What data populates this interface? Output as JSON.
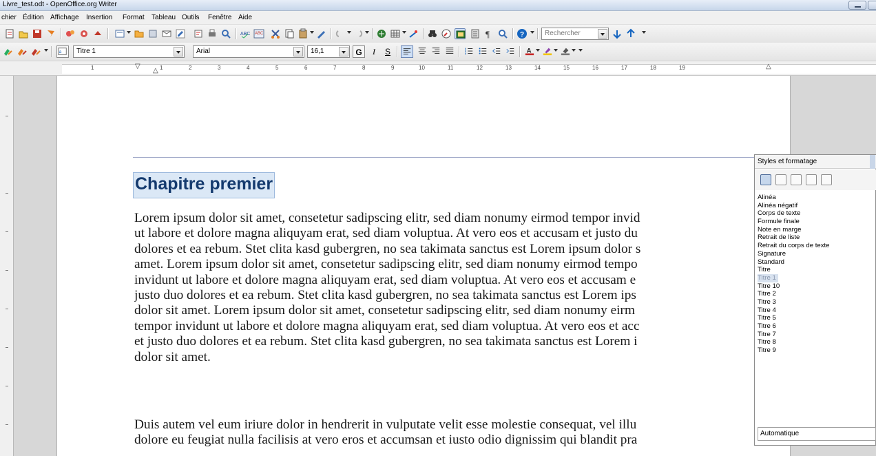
{
  "window": {
    "title": "Livre_test.odt - OpenOffice.org Writer"
  },
  "menu": [
    "chier",
    "Édition",
    "Affichage",
    "Insertion",
    "Format",
    "Tableau",
    "Outils",
    "Fenêtre",
    "Aide"
  ],
  "toolbar": {
    "search_placeholder": "Rechercher",
    "paragraph_style": "Titre 1",
    "font_name": "Arial",
    "font_size": "16,1"
  },
  "ruler": {
    "numbers": [
      "1",
      "1",
      "2",
      "3",
      "4",
      "5",
      "6",
      "7",
      "8",
      "9",
      "10",
      "11",
      "12",
      "13",
      "14",
      "15",
      "16",
      "17",
      "18",
      "19"
    ]
  },
  "document": {
    "heading": "Chapitre premier",
    "paragraph1": [
      "Lorem ipsum dolor sit amet, consetetur sadipscing elitr, sed diam nonumy eirmod tempor invid",
      "ut labore et dolore magna aliquyam erat, sed diam voluptua. At vero eos et accusam et justo du",
      "dolores et ea rebum. Stet clita kasd gubergren, no sea takimata sanctus est Lorem ipsum dolor s",
      "amet. Lorem ipsum dolor sit amet, consetetur sadipscing elitr, sed diam nonumy eirmod tempo",
      "invidunt ut labore et dolore magna aliquyam erat, sed diam voluptua. At vero eos et accusam e",
      "justo duo dolores et ea rebum. Stet clita kasd gubergren, no sea takimata sanctus est Lorem ips",
      "dolor sit amet. Lorem ipsum dolor sit amet, consetetur sadipscing elitr, sed diam nonumy eirm",
      "tempor invidunt ut labore et dolore magna aliquyam erat, sed diam voluptua. At vero eos et acc",
      "et justo duo dolores et ea rebum. Stet clita kasd gubergren, no sea takimata sanctus est Lorem i",
      "dolor sit amet."
    ],
    "paragraph2": [
      "Duis autem vel eum iriure dolor in hendrerit in vulputate velit esse molestie consequat, vel illu",
      "dolore eu feugiat nulla facilisis at vero eros et accumsan et iusto odio dignissim qui blandit pra"
    ]
  },
  "styles_panel": {
    "title": "Styles et formatage",
    "styles": [
      "Alinéa",
      "Alinéa négatif",
      "Corps de texte",
      "Formule finale",
      "Note en marge",
      "Retrait de liste",
      "Retrait du corps de texte",
      "Signature",
      "Standard",
      "Titre",
      "Titre 1",
      "Titre 10",
      "Titre 2",
      "Titre 3",
      "Titre 4",
      "Titre 5",
      "Titre 6",
      "Titre 7",
      "Titre 8",
      "Titre 9"
    ],
    "selected_style": "Titre 1",
    "filter": "Automatique"
  },
  "icons": {
    "standard_toolbar": [
      "new-icon",
      "open-icon",
      "save-icon",
      "email-icon",
      "edit-icon",
      "export-pdf-icon",
      "print-icon",
      "preview-icon",
      "spellcheck-icon",
      "autospell-icon",
      "cut-icon",
      "copy-icon",
      "paste-icon",
      "format-paintbrush-icon",
      "undo-icon",
      "redo-icon",
      "hyperlink-icon",
      "table-icon",
      "draw-icon",
      "find-replace-icon",
      "navigator-icon",
      "gallery-icon",
      "data-sources-icon",
      "formatting-marks-icon",
      "zoom-icon",
      "help-icon"
    ],
    "format_toolbar": [
      "styles-formatting-icon",
      "apply-style-icon",
      "new-style-icon",
      "bold-icon",
      "italic-icon",
      "underline-icon",
      "align-left-icon",
      "align-center-icon",
      "align-right-icon",
      "justify-icon",
      "numbering-icon",
      "bullets-icon",
      "decrease-indent-icon",
      "increase-indent-icon",
      "font-color-icon",
      "highlight-icon",
      "background-color-icon"
    ]
  },
  "colors": {
    "heading": "#143a6e",
    "selection": "#dbe8f6",
    "spellcheck": "#d94040"
  }
}
